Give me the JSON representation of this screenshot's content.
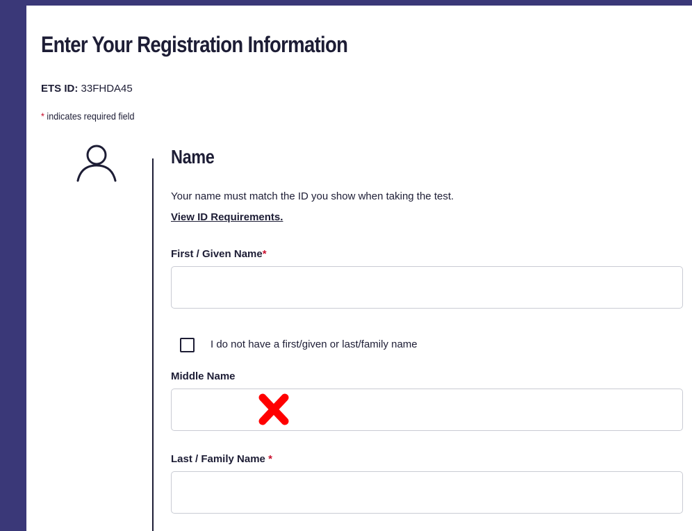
{
  "page": {
    "title": "Enter Your Registration Information",
    "ets_id_label": "ETS ID:",
    "ets_id_value": "33FHDA45",
    "required_star": "*",
    "required_note": "indicates required field",
    "frame_color": "#3a3878",
    "required_color": "#c8102e"
  },
  "name_section": {
    "icon": "person-icon",
    "title": "Name",
    "description": "Your name must match the ID you show when taking the test.",
    "link_label": "View ID Requirements.",
    "fields": {
      "first": {
        "label": "First / Given Name",
        "star": "*",
        "value": "",
        "placeholder": ""
      },
      "no_name_checkbox": {
        "label": "I do not have a first/given or last/family name",
        "checked": false
      },
      "middle": {
        "label": "Middle Name",
        "value": "",
        "placeholder": ""
      },
      "last": {
        "label": "Last / Family Name",
        "star": "*",
        "value": "",
        "placeholder": ""
      }
    },
    "annotation": {
      "icon": "red-x-mark-icon",
      "color": "#ff0000"
    }
  }
}
